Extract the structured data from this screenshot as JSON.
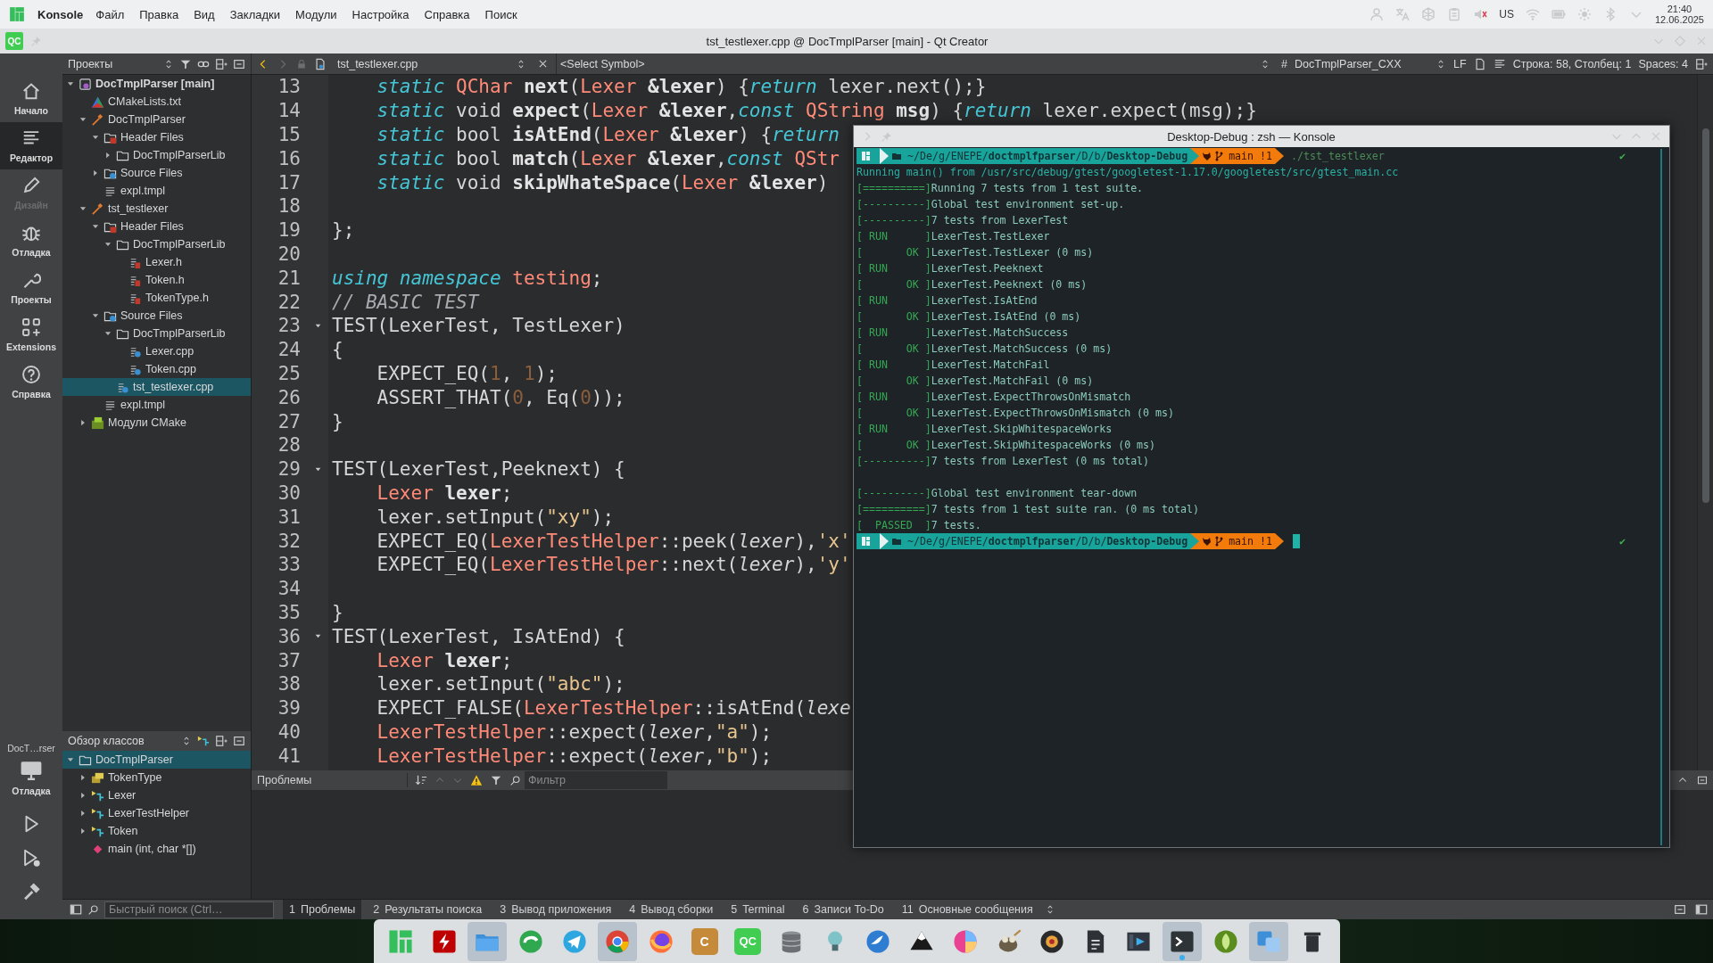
{
  "top_panel": {
    "app_name": "Konsole",
    "menu": [
      "Файл",
      "Правка",
      "Вид",
      "Закладки",
      "Модули",
      "Настройка",
      "Справка",
      "Поиск"
    ],
    "keyboard_layout": "US",
    "clock": {
      "time": "21:40",
      "date": "12.06.2025"
    }
  },
  "window": {
    "app_icon_label": "QC",
    "title": "tst_testlexer.cpp @ DocTmplParser [main] - Qt Creator"
  },
  "mode_bar": {
    "modes": [
      {
        "label": "Начало",
        "selected": false,
        "disabled": false
      },
      {
        "label": "Редактор",
        "selected": true,
        "disabled": false
      },
      {
        "label": "Дизайн",
        "selected": false,
        "disabled": true
      },
      {
        "label": "Отладка",
        "selected": false,
        "disabled": false
      },
      {
        "label": "Проекты",
        "selected": false,
        "disabled": false
      },
      {
        "label": "Extensions",
        "selected": false,
        "disabled": false
      },
      {
        "label": "Справка",
        "selected": false,
        "disabled": false
      }
    ],
    "target": "DocT…rser",
    "run_config": "Отладка"
  },
  "toolbar": {
    "projects_view": "Проекты",
    "back_enabled": true,
    "forward_enabled": false,
    "open_file": "tst_testlexer.cpp",
    "symbol": "<Select Symbol>",
    "hash": "#",
    "code_model": "DocTmplParser_CXX",
    "line_ending": "LF",
    "cursor_position": "Строка: 58, Столбец: 1",
    "indentation": "Spaces: 4"
  },
  "project_tree": {
    "items": [
      {
        "label": "DocTmplParser [main]",
        "kind": "project",
        "expanded": true,
        "selected": false,
        "children": [
          {
            "label": "CMakeLists.txt",
            "kind": "cmake",
            "selected": false
          },
          {
            "label": "DocTmplParser",
            "kind": "target",
            "expanded": true,
            "selected": false,
            "children": [
              {
                "label": "Header Files",
                "kind": "header_folder",
                "expanded": true,
                "selected": false,
                "children": [
                  {
                    "label": "DocTmplParserLib",
                    "kind": "folder",
                    "expanded": false,
                    "selected": false
                  }
                ]
              },
              {
                "label": "Source Files",
                "kind": "source_folder",
                "expanded": false,
                "selected": false
              },
              {
                "label": "expl.tmpl",
                "kind": "text_file",
                "selected": false
              }
            ]
          },
          {
            "label": "tst_testlexer",
            "kind": "target",
            "expanded": true,
            "selected": false,
            "children": [
              {
                "label": "Header Files",
                "kind": "header_folder",
                "expanded": true,
                "selected": false,
                "children": [
                  {
                    "label": "DocTmplParserLib",
                    "kind": "folder",
                    "expanded": true,
                    "selected": false,
                    "children": [
                      {
                        "label": "Lexer.h",
                        "kind": "header_file",
                        "selected": false
                      },
                      {
                        "label": "Token.h",
                        "kind": "header_file",
                        "selected": false
                      },
                      {
                        "label": "TokenType.h",
                        "kind": "header_file",
                        "selected": false
                      }
                    ]
                  }
                ]
              },
              {
                "label": "Source Files",
                "kind": "source_folder",
                "expanded": true,
                "selected": false,
                "children": [
                  {
                    "label": "DocTmplParserLib",
                    "kind": "folder",
                    "expanded": true,
                    "selected": false,
                    "children": [
                      {
                        "label": "Lexer.cpp",
                        "kind": "source_file",
                        "selected": false
                      },
                      {
                        "label": "Token.cpp",
                        "kind": "source_file",
                        "selected": false
                      }
                    ]
                  },
                  {
                    "label": "tst_testlexer.cpp",
                    "kind": "source_file",
                    "selected": true
                  }
                ]
              },
              {
                "label": "expl.tmpl",
                "kind": "text_file",
                "selected": false
              }
            ]
          },
          {
            "label": "Модули CMake",
            "kind": "cmake_modules",
            "expanded": false,
            "selected": false
          }
        ]
      }
    ]
  },
  "class_view": {
    "title": "Обзор классов",
    "items": [
      {
        "label": "DocTmplParser",
        "kind": "namespace",
        "expanded": true,
        "selected": true,
        "children": [
          {
            "label": "TokenType",
            "kind": "enum",
            "expanded": false,
            "selected": false
          },
          {
            "label": "Lexer",
            "kind": "class",
            "expanded": false,
            "selected": false
          },
          {
            "label": "LexerTestHelper",
            "kind": "class",
            "expanded": false,
            "selected": false
          },
          {
            "label": "Token",
            "kind": "class",
            "expanded": false,
            "selected": false
          },
          {
            "label": "main (int, char *[])",
            "kind": "function",
            "selected": false
          }
        ]
      }
    ]
  },
  "editor": {
    "lines": [
      {
        "number": "13",
        "fold": false,
        "tokens": [
          {
            "kind": "keyword",
            "text": "    static "
          },
          {
            "kind": "type",
            "text": "QChar "
          },
          {
            "kind": "bold",
            "text": "next"
          },
          {
            "kind": "plain",
            "text": "("
          },
          {
            "kind": "type",
            "text": "Lexer "
          },
          {
            "kind": "bold",
            "text": "&lexer"
          },
          {
            "kind": "plain",
            "text": ") {"
          },
          {
            "kind": "keyword",
            "text": "return"
          },
          {
            "kind": "plain",
            "text": " lexer.next();}"
          }
        ]
      },
      {
        "number": "14",
        "fold": false,
        "tokens": [
          {
            "kind": "keyword",
            "text": "    static"
          },
          {
            "kind": "plain",
            "text": " void "
          },
          {
            "kind": "bold",
            "text": "expect"
          },
          {
            "kind": "plain",
            "text": "("
          },
          {
            "kind": "type",
            "text": "Lexer "
          },
          {
            "kind": "bold",
            "text": "&lexer"
          },
          {
            "kind": "plain",
            "text": ","
          },
          {
            "kind": "keyword",
            "text": "const "
          },
          {
            "kind": "type",
            "text": "QString "
          },
          {
            "kind": "bold",
            "text": "msg"
          },
          {
            "kind": "plain",
            "text": ") {"
          },
          {
            "kind": "keyword",
            "text": "return"
          },
          {
            "kind": "plain",
            "text": " lexer.expect(msg);}"
          }
        ]
      },
      {
        "number": "15",
        "fold": false,
        "tokens": [
          {
            "kind": "keyword",
            "text": "    static"
          },
          {
            "kind": "plain",
            "text": " bool "
          },
          {
            "kind": "bold",
            "text": "isAtEnd"
          },
          {
            "kind": "plain",
            "text": "("
          },
          {
            "kind": "type",
            "text": "Lexer "
          },
          {
            "kind": "bold",
            "text": "&lexer"
          },
          {
            "kind": "plain",
            "text": ") {"
          },
          {
            "kind": "keyword",
            "text": "return"
          }
        ]
      },
      {
        "number": "16",
        "fold": false,
        "tokens": [
          {
            "kind": "keyword",
            "text": "    static"
          },
          {
            "kind": "plain",
            "text": " bool "
          },
          {
            "kind": "bold",
            "text": "match"
          },
          {
            "kind": "plain",
            "text": "("
          },
          {
            "kind": "type",
            "text": "Lexer "
          },
          {
            "kind": "bold",
            "text": "&lexer"
          },
          {
            "kind": "plain",
            "text": ","
          },
          {
            "kind": "keyword",
            "text": "const "
          },
          {
            "kind": "type",
            "text": "QStr"
          }
        ]
      },
      {
        "number": "17",
        "fold": false,
        "tokens": [
          {
            "kind": "keyword",
            "text": "    static"
          },
          {
            "kind": "plain",
            "text": " void "
          },
          {
            "kind": "bold",
            "text": "skipWhateSpace"
          },
          {
            "kind": "plain",
            "text": "("
          },
          {
            "kind": "type",
            "text": "Lexer "
          },
          {
            "kind": "bold",
            "text": "&lexer"
          },
          {
            "kind": "plain",
            "text": ")"
          }
        ]
      },
      {
        "number": "18",
        "fold": false
      },
      {
        "number": "19",
        "fold": false,
        "tokens": [
          {
            "kind": "plain",
            "text": "};"
          }
        ]
      },
      {
        "number": "20",
        "fold": false
      },
      {
        "number": "21",
        "fold": false,
        "tokens": [
          {
            "kind": "keyword",
            "text": "using namespace "
          },
          {
            "kind": "type",
            "text": "testing"
          },
          {
            "kind": "plain",
            "text": ";"
          }
        ]
      },
      {
        "number": "22",
        "fold": false,
        "tokens": [
          {
            "kind": "comment",
            "text": "// BASIC TEST"
          }
        ]
      },
      {
        "number": "23",
        "fold": true,
        "tokens": [
          {
            "kind": "plain",
            "text": "TEST(LexerTest, TestLexer)"
          }
        ]
      },
      {
        "number": "24",
        "fold": false,
        "tokens": [
          {
            "kind": "plain",
            "text": "{"
          }
        ]
      },
      {
        "number": "25",
        "fold": false,
        "tokens": [
          {
            "kind": "plain",
            "text": "    EXPECT_EQ("
          },
          {
            "kind": "number",
            "text": "1"
          },
          {
            "kind": "plain",
            "text": ", "
          },
          {
            "kind": "number",
            "text": "1"
          },
          {
            "kind": "plain",
            "text": ");"
          }
        ]
      },
      {
        "number": "26",
        "fold": false,
        "tokens": [
          {
            "kind": "plain",
            "text": "    ASSERT_THAT("
          },
          {
            "kind": "number",
            "text": "0"
          },
          {
            "kind": "plain",
            "text": ", Eq("
          },
          {
            "kind": "number",
            "text": "0"
          },
          {
            "kind": "plain",
            "text": "));"
          }
        ]
      },
      {
        "number": "27",
        "fold": false,
        "tokens": [
          {
            "kind": "plain",
            "text": "}"
          }
        ]
      },
      {
        "number": "28",
        "fold": false
      },
      {
        "number": "29",
        "fold": true,
        "tokens": [
          {
            "kind": "plain",
            "text": "TEST(LexerTest,Peeknext) {"
          }
        ]
      },
      {
        "number": "30",
        "fold": false,
        "tokens": [
          {
            "kind": "type",
            "text": "    Lexer "
          },
          {
            "kind": "bold",
            "text": "lexer"
          },
          {
            "kind": "plain",
            "text": ";"
          }
        ]
      },
      {
        "number": "31",
        "fold": false,
        "tokens": [
          {
            "kind": "plain",
            "text": "    lexer.setInput("
          },
          {
            "kind": "string",
            "text": "\"xy\""
          },
          {
            "kind": "plain",
            "text": ");"
          }
        ]
      },
      {
        "number": "32",
        "fold": false,
        "tokens": [
          {
            "kind": "plain",
            "text": "    EXPECT_EQ("
          },
          {
            "kind": "type",
            "text": "LexerTestHelper"
          },
          {
            "kind": "plain",
            "text": "::peek("
          },
          {
            "kind": "param",
            "text": "lexer"
          },
          {
            "kind": "plain",
            "text": "),"
          },
          {
            "kind": "string",
            "text": "'x'"
          }
        ]
      },
      {
        "number": "33",
        "fold": false,
        "tokens": [
          {
            "kind": "plain",
            "text": "    EXPECT_EQ("
          },
          {
            "kind": "type",
            "text": "LexerTestHelper"
          },
          {
            "kind": "plain",
            "text": "::next("
          },
          {
            "kind": "param",
            "text": "lexer"
          },
          {
            "kind": "plain",
            "text": "),"
          },
          {
            "kind": "string",
            "text": "'y'"
          }
        ]
      },
      {
        "number": "34",
        "fold": false
      },
      {
        "number": "35",
        "fold": false,
        "tokens": [
          {
            "kind": "plain",
            "text": "}"
          }
        ]
      },
      {
        "number": "36",
        "fold": true,
        "tokens": [
          {
            "kind": "plain",
            "text": "TEST(LexerTest, IsAtEnd) {"
          }
        ]
      },
      {
        "number": "37",
        "fold": false,
        "tokens": [
          {
            "kind": "type",
            "text": "    Lexer "
          },
          {
            "kind": "bold",
            "text": "lexer"
          },
          {
            "kind": "plain",
            "text": ";"
          }
        ]
      },
      {
        "number": "38",
        "fold": false,
        "tokens": [
          {
            "kind": "plain",
            "text": "    lexer.setInput("
          },
          {
            "kind": "string",
            "text": "\"abc\""
          },
          {
            "kind": "plain",
            "text": ");"
          }
        ]
      },
      {
        "number": "39",
        "fold": false,
        "tokens": [
          {
            "kind": "plain",
            "text": "    EXPECT_FALSE("
          },
          {
            "kind": "type",
            "text": "LexerTestHelper"
          },
          {
            "kind": "plain",
            "text": "::isAtEnd("
          },
          {
            "kind": "param",
            "text": "lexe"
          }
        ]
      },
      {
        "number": "40",
        "fold": false,
        "tokens": [
          {
            "kind": "type",
            "text": "    LexerTestHelper"
          },
          {
            "kind": "plain",
            "text": "::expect("
          },
          {
            "kind": "param",
            "text": "lexer"
          },
          {
            "kind": "plain",
            "text": ","
          },
          {
            "kind": "string",
            "text": "\"a\""
          },
          {
            "kind": "plain",
            "text": ");"
          }
        ]
      },
      {
        "number": "41",
        "fold": false,
        "tokens": [
          {
            "kind": "type",
            "text": "    LexerTestHelper"
          },
          {
            "kind": "plain",
            "text": "::expect("
          },
          {
            "kind": "param",
            "text": "lexer"
          },
          {
            "kind": "plain",
            "text": ","
          },
          {
            "kind": "string",
            "text": "\"b\""
          },
          {
            "kind": "plain",
            "text": ");"
          }
        ]
      }
    ]
  },
  "problems_pane": {
    "title": "Проблемы",
    "filter_placeholder": "Фильтр"
  },
  "status_bar": {
    "search_placeholder": "Быстрый поиск (Ctrl…",
    "tabs": [
      {
        "number": "1",
        "label": "Проблемы",
        "selected": true
      },
      {
        "number": "2",
        "label": "Результаты поиска",
        "selected": false
      },
      {
        "number": "3",
        "label": "Вывод приложения",
        "selected": false
      },
      {
        "number": "4",
        "label": "Вывод сборки",
        "selected": false
      },
      {
        "number": "5",
        "label": "Terminal",
        "selected": false
      },
      {
        "number": "6",
        "label": "Записи To-Do",
        "selected": false
      },
      {
        "number": "11",
        "label": "Основные сообщения",
        "selected": false
      }
    ]
  },
  "konsole": {
    "title": "Desktop-Debug : zsh — Konsole",
    "lines": [
      {
        "kind": "prompt",
        "path": "~/De/g/ENEPE/**doctmplfparser**/D/b/**Desktop-Debug**",
        "branch": "main !1",
        "command": "./tst_testlexer",
        "status": "✔",
        "cursor": false
      },
      {
        "kind": "output",
        "text": "Running main() from /usr/src/debug/gtest/googletest-1.17.0/googletest/src/gtest_main.cc"
      },
      {
        "kind": "output",
        "tag": "[==========]",
        "text": "Running 7 tests from 1 test suite."
      },
      {
        "kind": "output",
        "tag": "[----------]",
        "text": "Global test environment set-up."
      },
      {
        "kind": "output",
        "tag": "[----------]",
        "text": "7 tests from LexerTest"
      },
      {
        "kind": "output",
        "tag": "[ RUN      ]",
        "text": "LexerTest.TestLexer"
      },
      {
        "kind": "output",
        "tag": "[       OK ]",
        "text": "LexerTest.TestLexer (0 ms)"
      },
      {
        "kind": "output",
        "tag": "[ RUN      ]",
        "text": "LexerTest.Peeknext"
      },
      {
        "kind": "output",
        "tag": "[       OK ]",
        "text": "LexerTest.Peeknext (0 ms)"
      },
      {
        "kind": "output",
        "tag": "[ RUN      ]",
        "text": "LexerTest.IsAtEnd"
      },
      {
        "kind": "output",
        "tag": "[       OK ]",
        "text": "LexerTest.IsAtEnd (0 ms)"
      },
      {
        "kind": "output",
        "tag": "[ RUN      ]",
        "text": "LexerTest.MatchSuccess"
      },
      {
        "kind": "output",
        "tag": "[       OK ]",
        "text": "LexerTest.MatchSuccess (0 ms)"
      },
      {
        "kind": "output",
        "tag": "[ RUN      ]",
        "text": "LexerTest.MatchFail"
      },
      {
        "kind": "output",
        "tag": "[       OK ]",
        "text": "LexerTest.MatchFail (0 ms)"
      },
      {
        "kind": "output",
        "tag": "[ RUN      ]",
        "text": "LexerTest.ExpectThrowsOnMismatch"
      },
      {
        "kind": "output",
        "tag": "[       OK ]",
        "text": "LexerTest.ExpectThrowsOnMismatch (0 ms)"
      },
      {
        "kind": "output",
        "tag": "[ RUN      ]",
        "text": "LexerTest.SkipWhitespaceWorks"
      },
      {
        "kind": "output",
        "tag": "[       OK ]",
        "text": "LexerTest.SkipWhitespaceWorks (0 ms)"
      },
      {
        "kind": "output",
        "tag": "[----------]",
        "text": "7 tests from LexerTest (0 ms total)"
      },
      {
        "kind": "blank"
      },
      {
        "kind": "output",
        "tag": "[----------]",
        "text": "Global test environment tear-down"
      },
      {
        "kind": "output",
        "tag": "[==========]",
        "text": "7 tests from 1 test suite ran. (0 ms total)"
      },
      {
        "kind": "output",
        "tag": "[  PASSED  ]",
        "text": "7 tests."
      },
      {
        "kind": "prompt",
        "path": "~/De/g/ENEPE/**doctmplfparser**/D/b/**Desktop-Debug**",
        "branch": "main !1",
        "status": "✔",
        "cursor": true
      }
    ]
  },
  "dock": {
    "items": [
      {
        "highlighted": false,
        "running": false
      },
      {
        "highlighted": false,
        "running": false
      },
      {
        "highlighted": true,
        "running": false
      },
      {
        "highlighted": false,
        "running": false
      },
      {
        "highlighted": false,
        "running": false
      },
      {
        "highlighted": true,
        "running": false
      },
      {
        "highlighted": false,
        "running": false
      },
      {
        "label": "C",
        "highlighted": false,
        "running": false
      },
      {
        "label": "QC",
        "highlighted": false,
        "running": false
      },
      {
        "highlighted": false,
        "running": false
      },
      {
        "highlighted": false,
        "running": false
      },
      {
        "highlighted": false,
        "running": false
      },
      {
        "highlighted": false,
        "running": false
      },
      {
        "highlighted": false,
        "running": false
      },
      {
        "highlighted": false,
        "running": false
      },
      {
        "highlighted": false,
        "running": false
      },
      {
        "highlighted": false,
        "running": false
      },
      {
        "highlighted": false,
        "running": false
      },
      {
        "highlighted": true,
        "running": true
      },
      {
        "highlighted": false,
        "running": false
      },
      {
        "highlighted": true,
        "running": false
      },
      {
        "highlighted": false,
        "running": false
      }
    ]
  }
}
